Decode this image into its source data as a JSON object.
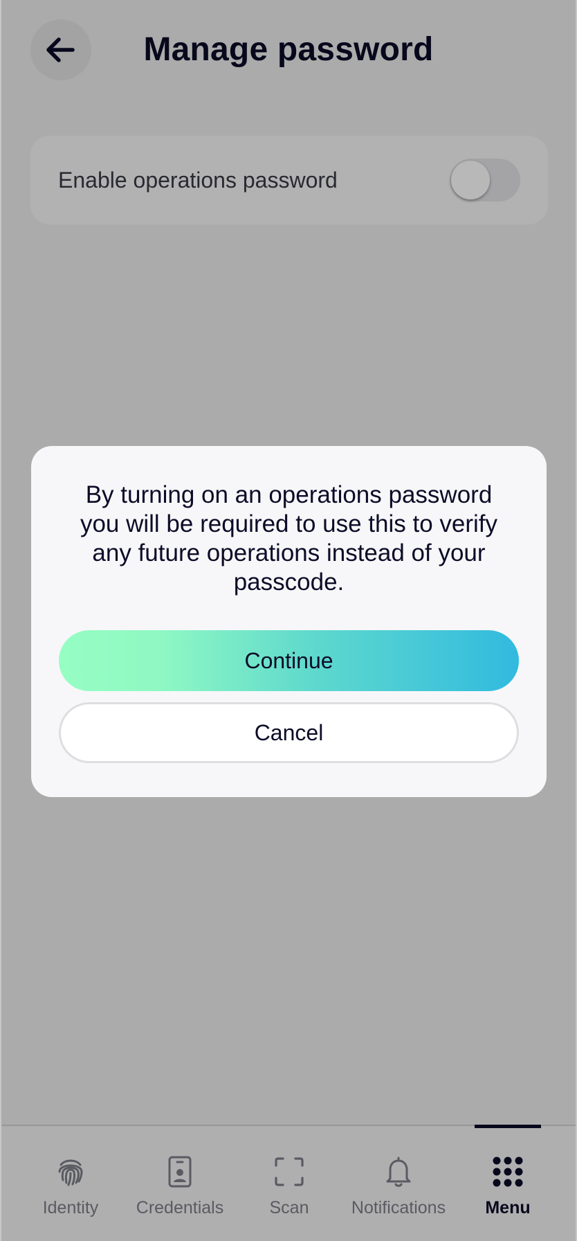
{
  "header": {
    "title": "Manage password",
    "back_icon": "arrow-left-icon"
  },
  "settings": {
    "toggle_label": "Enable operations password",
    "toggle_on": false
  },
  "dialog": {
    "message": "By turning on an operations password you will be required to use this to verify any future operations instead of your passcode.",
    "continue_label": "Continue",
    "cancel_label": "Cancel"
  },
  "tabbar": {
    "items": [
      {
        "label": "Identity",
        "icon": "fingerprint-icon"
      },
      {
        "label": "Credentials",
        "icon": "id-badge-icon"
      },
      {
        "label": "Scan",
        "icon": "scan-frame-icon"
      },
      {
        "label": "Notifications",
        "icon": "bell-icon"
      },
      {
        "label": "Menu",
        "icon": "grid-dots-icon"
      }
    ],
    "active": "Menu"
  },
  "colors": {
    "text_primary": "#0c0c28",
    "gradient_start": "#96fec3",
    "gradient_end": "#31badf"
  }
}
